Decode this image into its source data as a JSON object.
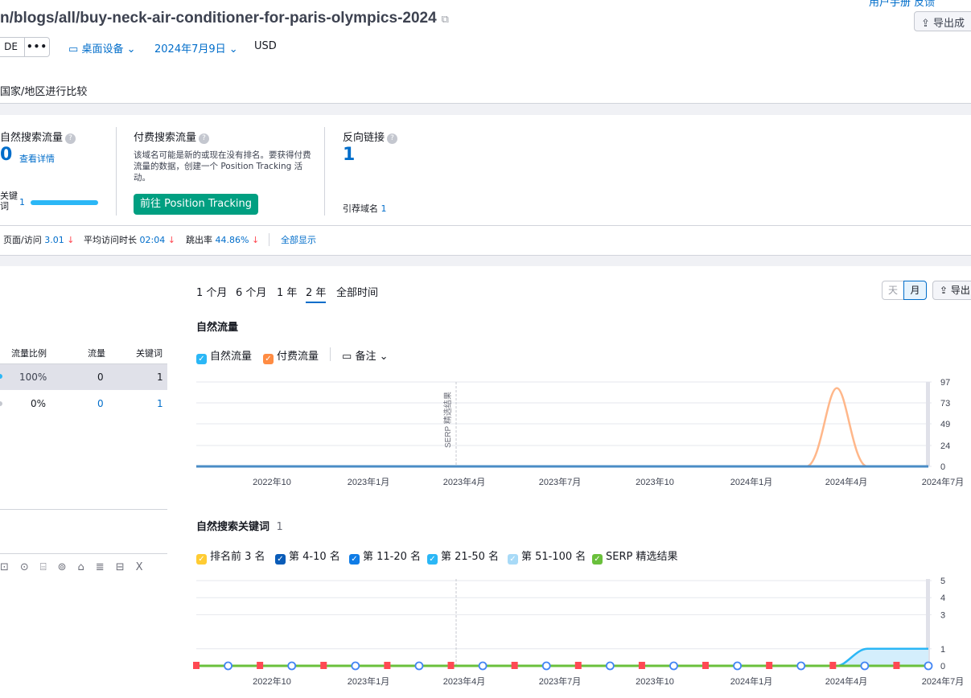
{
  "header": {
    "url_title": "n/blogs/all/buy-neck-air-conditioner-for-paris-olympics-2024",
    "top_links": "用户手册   反馈",
    "export_label": "导出成",
    "db_label": "DE",
    "more_label": "•••",
    "device_label": "桌面设备",
    "date_label": "2024年7月9日",
    "currency_label": "USD",
    "compare_label": "国家/地区进行比较"
  },
  "cards": {
    "organic": {
      "title": "自然搜索流量",
      "value": "0",
      "link": "查看详情",
      "kw_label": "关键\n词",
      "kw_value": "1"
    },
    "paid": {
      "title": "付费搜索流量",
      "desc": "该域名可能是新的或现在没有排名。要获得付费流量的数据，创建一个 Position Tracking 活动。",
      "button": "前往 Position Tracking"
    },
    "backlinks": {
      "title": "反向链接",
      "value": "1",
      "ref_label": "引荐域名",
      "ref_value": "1"
    }
  },
  "metrics": {
    "pages_label": "页面/访问",
    "pages_value": "3.01",
    "duration_label": "平均访问时长",
    "duration_value": "02:04",
    "bounce_label": "跳出率",
    "bounce_value": "44.86%",
    "show_all": "全部显示",
    "down_arrow": "↓"
  },
  "table": {
    "headers": [
      "流量比例",
      "流量",
      "关键词"
    ],
    "rows": [
      {
        "share": "100%",
        "traffic": "0",
        "keywords": "1"
      },
      {
        "share": "0%",
        "traffic": "0",
        "keywords": "1"
      }
    ]
  },
  "range_tabs": [
    "1 个月",
    "6 个月",
    "1 年",
    "2 年",
    "全部时间"
  ],
  "active_range": "2 年",
  "granularity": {
    "day": "天",
    "month": "月",
    "export": "导出"
  },
  "traffic_chart": {
    "section_title": "自然流量",
    "legend": {
      "organic": "自然流量",
      "paid": "付费流量",
      "notes": "备注"
    },
    "annotation": "SERP 精选结果"
  },
  "keywords_chart": {
    "section_title": "自然搜索关键词",
    "count": "1",
    "legend": [
      "排名前 3 名",
      "第 4-10 名",
      "第 11-20 名",
      "第 21-50 名",
      "第 51-100 名",
      "SERP 精选结果"
    ],
    "legend_colors": [
      "#ffcc33",
      "#0a5cb8",
      "#0f7ce6",
      "#2bb7f6",
      "#a8daf7",
      "#6ac03c"
    ]
  },
  "chart_data": [
    {
      "type": "line",
      "title": "自然流量",
      "x_ticks": [
        "2022年10",
        "2023年1月",
        "2023年4月",
        "2023年7月",
        "2023年10",
        "2024年1月",
        "2024年4月",
        "2024年7月"
      ],
      "y_ticks": [
        0,
        24,
        49,
        73,
        97
      ],
      "ylim": [
        0,
        97
      ],
      "series": [
        {
          "name": "付费流量",
          "color": "#ffb78a",
          "x": [
            "2024年3月",
            "2024年4月",
            "2024年5月"
          ],
          "values": [
            0,
            90,
            0
          ]
        },
        {
          "name": "自然流量",
          "color": "#4a8cc6",
          "x": [
            "2022年7月",
            "2024年7月"
          ],
          "values": [
            0,
            0
          ]
        }
      ],
      "grid": true
    },
    {
      "type": "area",
      "title": "自然搜索关键词",
      "x_ticks": [
        "2022年10",
        "2023年1月",
        "2023年4月",
        "2023年7月",
        "2023年10",
        "2024年1月",
        "2024年4月",
        "2024年7月"
      ],
      "y_ticks": [
        0,
        1,
        3,
        4,
        5
      ],
      "ylim": [
        0,
        5
      ],
      "series": [
        {
          "name": "第 21-50 名",
          "color": "#2bb7f6",
          "x": [
            "2024年4月",
            "2024年5月",
            "2024年7月"
          ],
          "values": [
            0,
            1,
            1
          ]
        }
      ],
      "grid": true
    }
  ]
}
